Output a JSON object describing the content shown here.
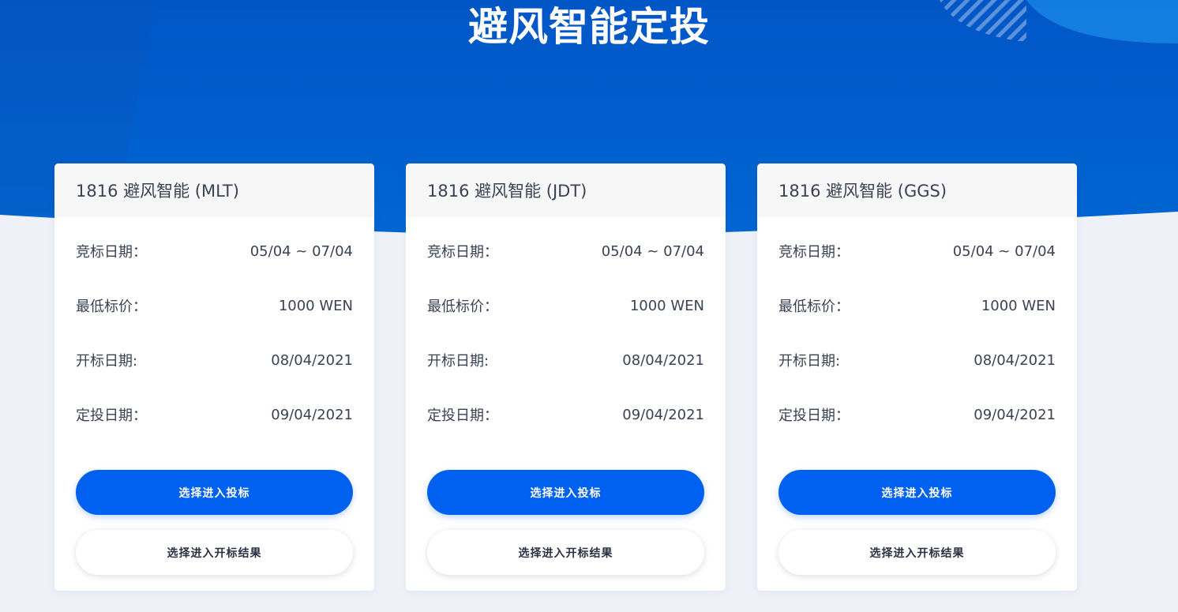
{
  "page": {
    "title": "避风智能定投"
  },
  "colors": {
    "hero_top": "#0058c8",
    "hero_bottom": "#0064cf",
    "page_bg": "#eef1f8",
    "primary_button": "#0060f0",
    "text": "#3a4253"
  },
  "cards": [
    {
      "title": "1816 避风智能 (MLT)",
      "rows": [
        {
          "label": "竞标日期：",
          "value": "05/04 ~ 07/04"
        },
        {
          "label": "最低标价：",
          "value": "1000 WEN"
        },
        {
          "label": "开标日期:",
          "value": "08/04/2021"
        },
        {
          "label": "定投日期：",
          "value": "09/04/2021"
        }
      ],
      "primary_button": "选择进入投标",
      "secondary_button": "选择进入开标结果"
    },
    {
      "title": "1816 避风智能 (JDT)",
      "rows": [
        {
          "label": "竞标日期：",
          "value": "05/04 ~ 07/04"
        },
        {
          "label": "最低标价：",
          "value": "1000 WEN"
        },
        {
          "label": "开标日期:",
          "value": "08/04/2021"
        },
        {
          "label": "定投日期：",
          "value": "09/04/2021"
        }
      ],
      "primary_button": "选择进入投标",
      "secondary_button": "选择进入开标结果"
    },
    {
      "title": "1816 避风智能 (GGS)",
      "rows": [
        {
          "label": "竞标日期：",
          "value": "05/04 ~ 07/04"
        },
        {
          "label": "最低标价：",
          "value": "1000 WEN"
        },
        {
          "label": "开标日期:",
          "value": "08/04/2021"
        },
        {
          "label": "定投日期：",
          "value": "09/04/2021"
        }
      ],
      "primary_button": "选择进入投标",
      "secondary_button": "选择进入开标结果"
    }
  ]
}
